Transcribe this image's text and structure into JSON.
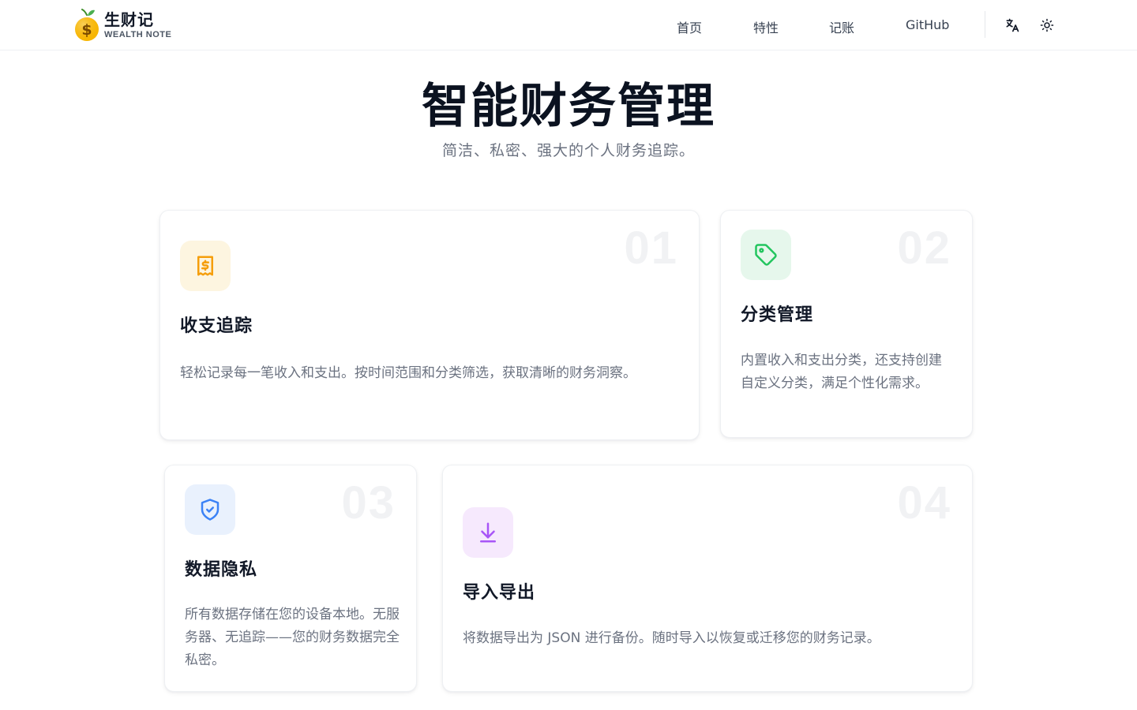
{
  "brand": {
    "name": "生财记",
    "subtitle": "WEALTH NOTE",
    "logo_icon": "orange-dollar-logo-icon"
  },
  "nav": {
    "links": [
      "首页",
      "特性",
      "记账",
      "GitHub"
    ],
    "translate_icon": "translate-icon",
    "theme_icon": "sun-icon"
  },
  "hero": {
    "title": "智能财务管理",
    "subtitle": "简洁、私密、强大的个人财务追踪。"
  },
  "features": [
    {
      "number": "01",
      "title": "收支追踪",
      "description": "轻松记录每一笔收入和支出。按时间范围和分类筛选，获取清晰的财务洞察。",
      "icon": "receipt-dollar-icon",
      "accent": "#f59e0b",
      "icon_bg": "#fdf5e0"
    },
    {
      "number": "02",
      "title": "分类管理",
      "description": "内置收入和支出分类，还支持创建自定义分类，满足个性化需求。",
      "icon": "tag-icon",
      "accent": "#22c55e",
      "icon_bg": "#e6f7ec"
    },
    {
      "number": "03",
      "title": "数据隐私",
      "description": "所有数据存储在您的设备本地。无服务器、无追踪——您的财务数据完全私密。",
      "icon": "shield-check-icon",
      "accent": "#3b82f6",
      "icon_bg": "#e9f1fd"
    },
    {
      "number": "04",
      "title": "导入导出",
      "description": "将数据导出为 JSON 进行备份。随时导入以恢复或迁移您的财务记录。",
      "icon": "download-icon",
      "accent": "#a855f7",
      "icon_bg": "#f6e9fd"
    }
  ]
}
